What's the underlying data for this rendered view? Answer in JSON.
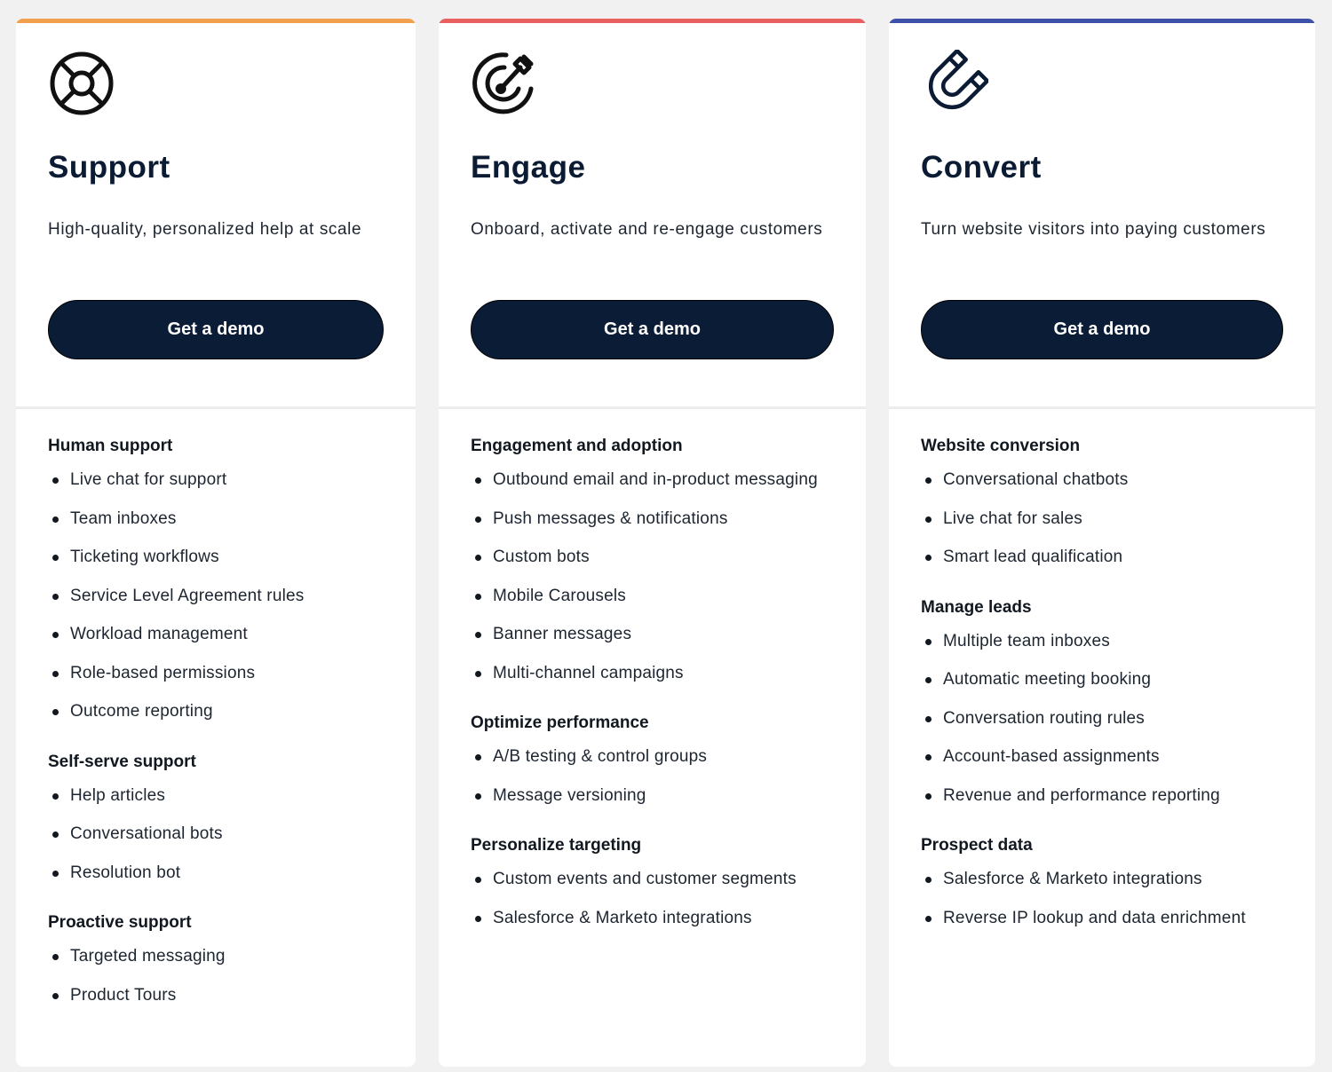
{
  "cards": [
    {
      "id": "support",
      "accent": "#f2a04d",
      "icon": "lifebuoy-icon",
      "title": "Support",
      "subtitle": "High-quality, personalized help at scale",
      "cta": "Get a demo",
      "sections": [
        {
          "title": "Human support",
          "items": [
            "Live chat for support",
            "Team inboxes",
            "Ticketing workflows",
            "Service Level Agreement rules",
            "Workload management",
            "Role-based permissions",
            "Outcome reporting"
          ]
        },
        {
          "title": "Self-serve support",
          "items": [
            "Help articles",
            "Conversational bots",
            "Resolution bot"
          ]
        },
        {
          "title": "Proactive support",
          "items": [
            "Targeted messaging",
            "Product Tours"
          ]
        }
      ]
    },
    {
      "id": "engage",
      "accent": "#e8605f",
      "icon": "target-arrow-icon",
      "title": "Engage",
      "subtitle": "Onboard, activate and re-engage customers",
      "cta": "Get a demo",
      "sections": [
        {
          "title": "Engagement and adoption",
          "items": [
            "Outbound email and in-product messaging",
            "Push messages & notifications",
            "Custom bots",
            "Mobile Carousels",
            "Banner messages",
            "Multi-channel campaigns"
          ]
        },
        {
          "title": "Optimize performance",
          "items": [
            "A/B testing & control groups",
            "Message versioning"
          ]
        },
        {
          "title": "Personalize targeting",
          "items": [
            "Custom events and customer segments",
            "Salesforce & Marketo integrations"
          ]
        }
      ]
    },
    {
      "id": "convert",
      "accent": "#3d51a8",
      "icon": "magnet-icon",
      "title": "Convert",
      "subtitle": "Turn website visitors into paying customers",
      "cta": "Get a demo",
      "sections": [
        {
          "title": "Website conversion",
          "items": [
            "Conversational chatbots",
            "Live chat for sales",
            "Smart lead qualification"
          ]
        },
        {
          "title": "Manage leads",
          "items": [
            "Multiple team inboxes",
            "Automatic meeting booking",
            "Conversation routing rules",
            "Account-based assignments",
            "Revenue and performance reporting"
          ]
        },
        {
          "title": "Prospect data",
          "items": [
            "Salesforce & Marketo integrations",
            "Reverse IP lookup and data enrichment"
          ]
        }
      ]
    }
  ]
}
